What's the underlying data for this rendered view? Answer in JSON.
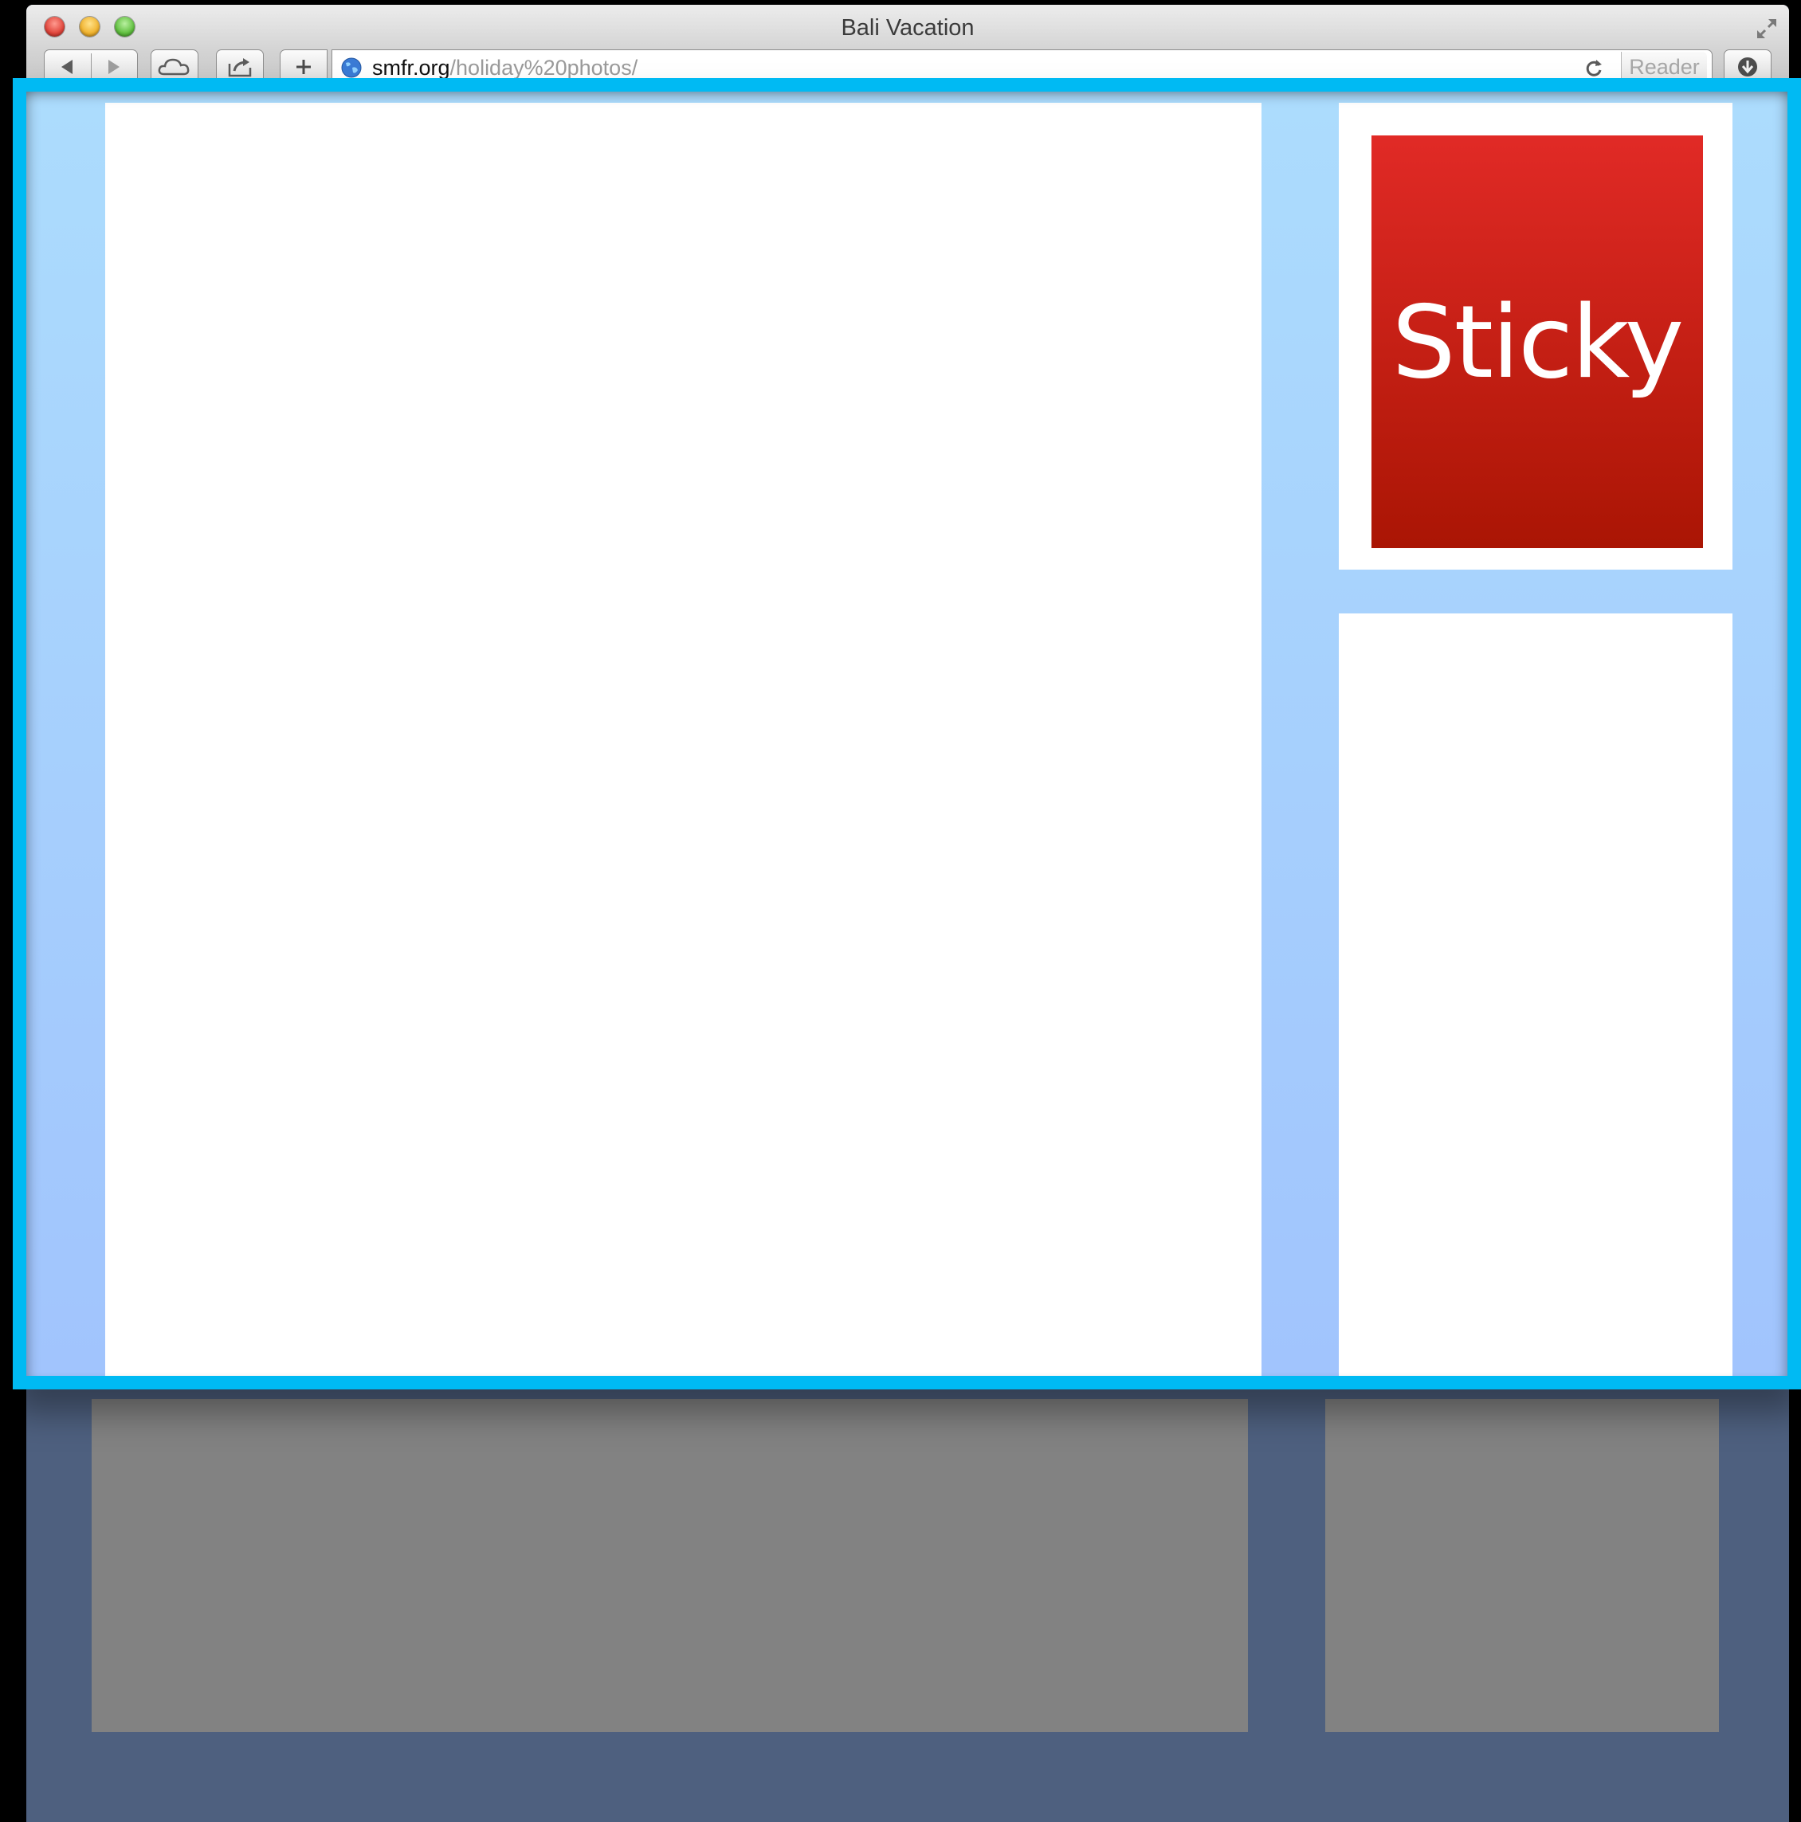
{
  "window": {
    "title": "Bali Vacation"
  },
  "toolbar": {
    "url_domain": "smfr.org",
    "url_path": "/holiday%20photos/",
    "reader_label": "Reader"
  },
  "page": {
    "sticky_label": "Sticky"
  },
  "colors": {
    "highlight_border": "#00baf3",
    "page_background": "#a1c4fd",
    "sticky_top": "#e12a26",
    "sticky_bottom": "#aa1504",
    "offscreen_overlay": "#4e607f"
  },
  "icons": [
    "close-icon",
    "minimize-icon",
    "zoom-icon",
    "fullscreen-icon",
    "back-icon",
    "forward-icon",
    "icloud-icon",
    "share-icon",
    "new-tab-icon",
    "globe-icon",
    "reload-icon",
    "downloads-icon"
  ]
}
